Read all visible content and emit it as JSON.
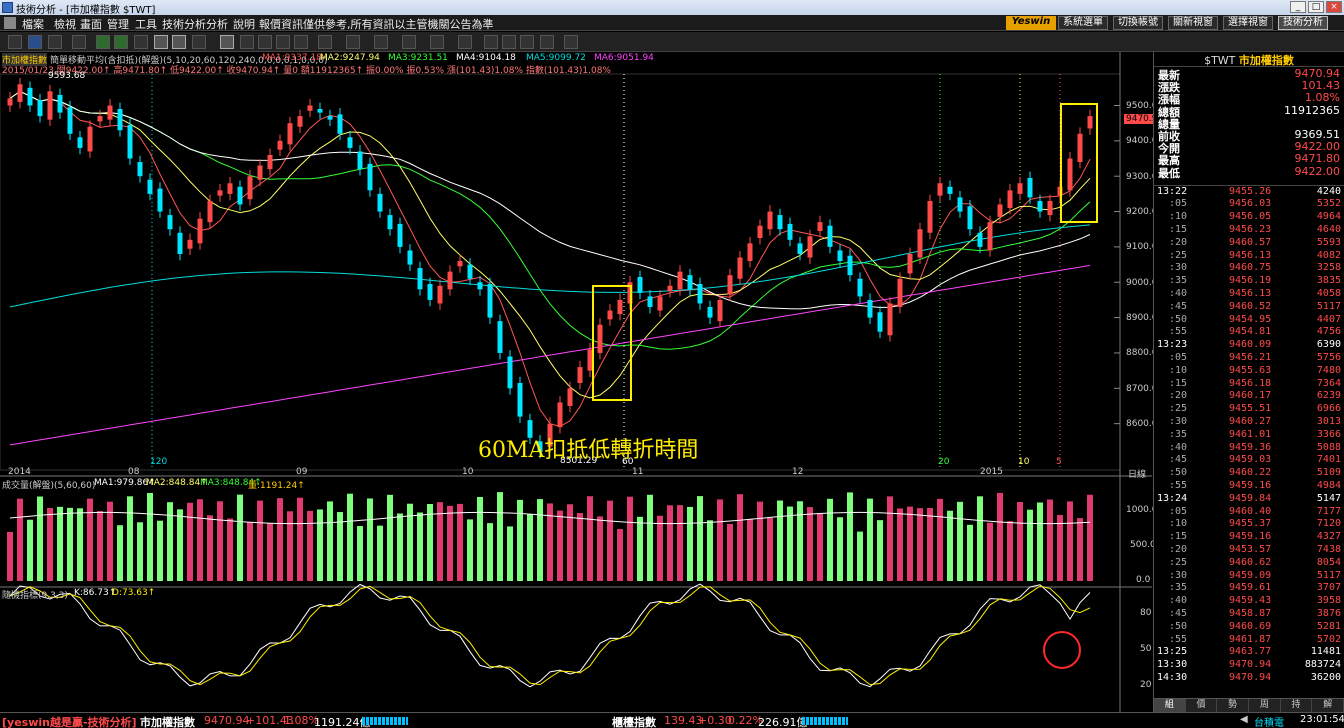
{
  "window": {
    "title": "技術分析 - [市加權指數 $TWT]"
  },
  "menu": [
    "檔案",
    "檢視",
    "畫面",
    "管理",
    "工具",
    "技術分析",
    "分析",
    "說明",
    "報價資訊僅供參考,所有資訊以主管機關公告為準"
  ],
  "brand": "Yeswin",
  "right_buttons": [
    "系統選單",
    "切換帳號",
    "關新視窗",
    "選擇視窗",
    "技術分析"
  ],
  "chart": {
    "symbol_tag": "市加權指數",
    "indicator_main": "簡單移動平均(含扣抵)(解盤)(5,10,20,60,120,240,0,0,0,0,1,0,0,0)",
    "ma_labels": [
      {
        "text": "MA1:9337.18",
        "color": "#ff5555"
      },
      {
        "text": "MA2:9247.94",
        "color": "#ffff66"
      },
      {
        "text": "MA3:9231.51",
        "color": "#33ff33"
      },
      {
        "text": "MA4:9104.18",
        "color": "#ffffff"
      },
      {
        "text": "MA5:9099.72",
        "color": "#00dddd"
      },
      {
        "text": "MA6:9051.94",
        "color": "#ff44ff"
      }
    ],
    "info_line": "2015/01/23 開9422.00↑ 高9471.80↑ 低9422.00↑ 收9470.94↑ 量0 額11912365↑ 振0.00% 振0.53% 漲(101.43)1.08% 指數(101.43)1.08%",
    "high_label": "9593.68",
    "low_label": "8501.29",
    "annotation": "60MA扣抵低轉折時間",
    "price_badge": "9470.9",
    "y_ticks": [
      "9500.0",
      "9400.0",
      "9300.0",
      "9200.0",
      "9100.0",
      "9000.0",
      "8900.0",
      "8800.0",
      "8700.0",
      "8600.0"
    ],
    "x_labels": [
      "2014",
      "08",
      "09",
      "10",
      "11",
      "12",
      "2015"
    ],
    "marker_labels": [
      {
        "text": "120",
        "color": "#00dddd"
      },
      {
        "text": "60",
        "color": "#ffffff"
      },
      {
        "text": "20",
        "color": "#33ff33"
      },
      {
        "text": "10",
        "color": "#ffff66"
      },
      {
        "text": "5",
        "color": "#ff5555"
      }
    ],
    "right_label": "日線",
    "volume": {
      "title": "成交量(解盤)(5,60,60)",
      "ma1": "MA1:979.86↑",
      "ma2": "MA2:848.84↑",
      "ma3": "MA3:848.84↑",
      "vol": "量:1191.24↑",
      "y_ticks": [
        "1000.0",
        "500.0",
        "0.0"
      ]
    },
    "kd": {
      "title": "隨機指標(9,3,3)",
      "k": "K:86.73↑",
      "d": "D:73.63↑",
      "y_ticks": [
        "80",
        "50",
        "20"
      ]
    }
  },
  "quote": {
    "symbol": "$TWT",
    "name": "市加權指數",
    "rows": [
      {
        "label": "最新",
        "value": "9470.94",
        "color": "#ff4a4a"
      },
      {
        "label": "漲跌",
        "value": "101.43",
        "color": "#ff4a4a"
      },
      {
        "label": "漲幅",
        "value": "1.08%",
        "color": "#ff4a4a"
      },
      {
        "label": "總額",
        "value": "11912365",
        "color": "#ffffff"
      },
      {
        "label": "總量",
        "value": "",
        "color": "#ffffff"
      },
      {
        "label": "前收",
        "value": "9369.51",
        "color": "#ffffff"
      },
      {
        "label": "今開",
        "value": "9422.00",
        "color": "#ff4a4a"
      },
      {
        "label": "最高",
        "value": "9471.80",
        "color": "#ff4a4a"
      },
      {
        "label": "最低",
        "value": "9422.00",
        "color": "#ff4a4a"
      }
    ],
    "ticks": [
      {
        "time": "13:22",
        "price": "9455.26",
        "vol": "4240",
        "major": true
      },
      {
        "time": ":05",
        "price": "9456.03",
        "vol": "5352"
      },
      {
        "time": ":10",
        "price": "9456.05",
        "vol": "4964"
      },
      {
        "time": ":15",
        "price": "9456.23",
        "vol": "4640"
      },
      {
        "time": ":20",
        "price": "9460.57",
        "vol": "5593"
      },
      {
        "time": ":25",
        "price": "9456.13",
        "vol": "4082"
      },
      {
        "time": ":30",
        "price": "9460.75",
        "vol": "3258"
      },
      {
        "time": ":35",
        "price": "9456.19",
        "vol": "3835"
      },
      {
        "time": ":40",
        "price": "9456.13",
        "vol": "4058"
      },
      {
        "time": ":45",
        "price": "9460.52",
        "vol": "5117"
      },
      {
        "time": ":50",
        "price": "9454.95",
        "vol": "4407"
      },
      {
        "time": ":55",
        "price": "9454.81",
        "vol": "4756"
      },
      {
        "time": "13:23",
        "price": "9460.09",
        "vol": "6390",
        "major": true
      },
      {
        "time": ":05",
        "price": "9456.21",
        "vol": "5756"
      },
      {
        "time": ":10",
        "price": "9455.63",
        "vol": "7480"
      },
      {
        "time": ":15",
        "price": "9456.18",
        "vol": "7364"
      },
      {
        "time": ":20",
        "price": "9460.17",
        "vol": "6239"
      },
      {
        "time": ":25",
        "price": "9455.51",
        "vol": "6966"
      },
      {
        "time": ":30",
        "price": "9460.27",
        "vol": "3013"
      },
      {
        "time": ":35",
        "price": "9461.01",
        "vol": "3366"
      },
      {
        "time": ":40",
        "price": "9459.36",
        "vol": "5088"
      },
      {
        "time": ":45",
        "price": "9459.03",
        "vol": "7401"
      },
      {
        "time": ":50",
        "price": "9460.22",
        "vol": "5109"
      },
      {
        "time": ":55",
        "price": "9459.16",
        "vol": "4984"
      },
      {
        "time": "13:24",
        "price": "9459.84",
        "vol": "5147",
        "major": true
      },
      {
        "time": ":05",
        "price": "9460.40",
        "vol": "7177"
      },
      {
        "time": ":10",
        "price": "9455.37",
        "vol": "7120"
      },
      {
        "time": ":15",
        "price": "9459.16",
        "vol": "4327"
      },
      {
        "time": ":20",
        "price": "9453.57",
        "vol": "7438"
      },
      {
        "time": ":25",
        "price": "9460.62",
        "vol": "8054"
      },
      {
        "time": ":30",
        "price": "9459.09",
        "vol": "5117"
      },
      {
        "time": ":35",
        "price": "9459.61",
        "vol": "3707"
      },
      {
        "time": ":40",
        "price": "9459.43",
        "vol": "3958"
      },
      {
        "time": ":45",
        "price": "9458.87",
        "vol": "3876"
      },
      {
        "time": ":50",
        "price": "9460.69",
        "vol": "5281"
      },
      {
        "time": ":55",
        "price": "9461.87",
        "vol": "5702"
      },
      {
        "time": "13:25",
        "price": "9463.77",
        "vol": "11481",
        "major": true
      },
      {
        "time": "13:30",
        "price": "9470.94",
        "vol": "883724",
        "major": true
      },
      {
        "time": "14:30",
        "price": "9470.94",
        "vol": "36200",
        "major": true
      }
    ],
    "tabs": [
      "組",
      "價",
      "勢",
      "周",
      "持",
      "解"
    ]
  },
  "status": {
    "left_app": "[yeswin越是贏-技術分析]",
    "index1_name": "市加權指數",
    "index1_value": "9470.94",
    "index1_change": "+101.43",
    "index1_pct": "1.08%",
    "index1_amount": "1191.24億",
    "index2_name": "櫃檯指數",
    "index2_value": "139.43",
    "index2_change": "+0.30",
    "index2_pct": "0.22%",
    "index2_amount": "226.91億",
    "right_label": "台積電",
    "time": "23:01:54"
  },
  "colors": {
    "up": "#ff4a4a",
    "down": "#00e5ff",
    "vol_up": "#e03a6e",
    "vol_down": "#7dff7d",
    "box": "#ffee00"
  }
}
